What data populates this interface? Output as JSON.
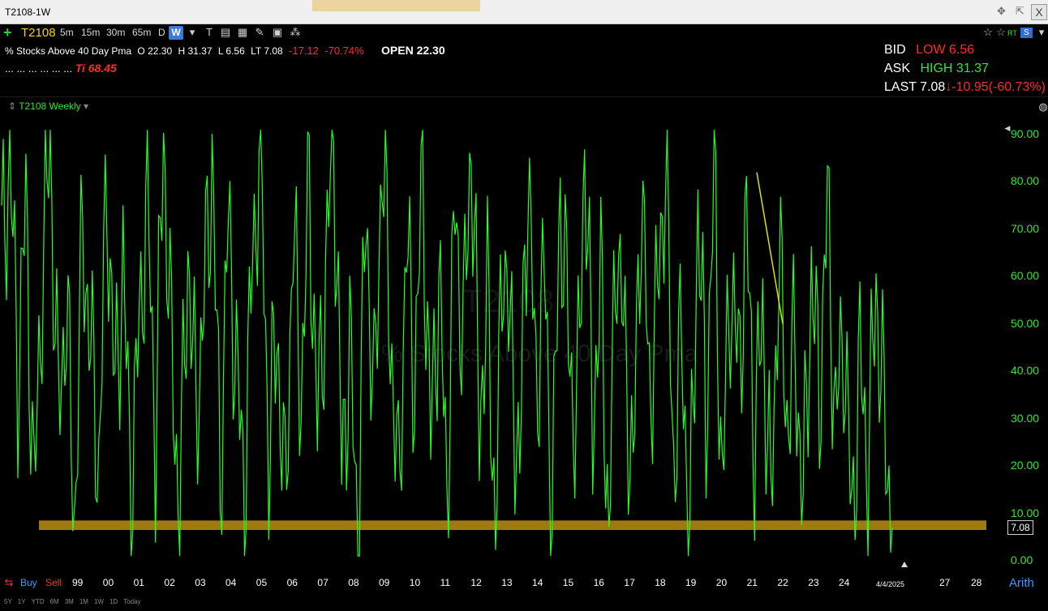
{
  "window": {
    "title": "T2108-1W"
  },
  "toolbar": {
    "symbol": "T2108",
    "intervals": [
      "5m",
      "15m",
      "30m",
      "65m",
      "D"
    ],
    "active_interval": "W",
    "rt_label": "RT"
  },
  "info": {
    "description": "% Stocks Above 40 Day Pma",
    "open": "O 22.30",
    "high": "H 31.37",
    "low": "L 6.56",
    "last": "LT 7.08",
    "change": "-17.12",
    "change_pct": "-70.74%",
    "open_label": "OPEN 22.30",
    "dots": "... ... ... ... ... ...",
    "ti": "Ti 68.45"
  },
  "quote": {
    "bid_label": "BID",
    "bid_value": "LOW 6.56",
    "ask_label": "ASK",
    "ask_value": "HIGH 31.37",
    "last_label": "LAST 7.08",
    "last_change": "-10.95",
    "last_pct": "(-60.73%)"
  },
  "chart_label": "T2108 Weekly",
  "watermark": "% Stocks Above 40 Day Pma",
  "watermark_symbol": "T2108",
  "current_price": "7.08",
  "bottom": {
    "buy": "Buy",
    "sell": "Sell",
    "scale": "Arith",
    "ranges": [
      "5Y",
      "1Y",
      "YTD",
      "6M",
      "3M",
      "1M",
      "1W",
      "1D",
      "Today"
    ]
  },
  "colors": {
    "series": "#22ff22",
    "band": "#a07a10",
    "trendline": "#e0e000"
  },
  "chart_data": {
    "type": "line",
    "title": "",
    "series_name": "T2108 Weekly",
    "y_ticks": [
      "90.00",
      "80.00",
      "70.00",
      "60.00",
      "50.00",
      "40.00",
      "30.00",
      "20.00",
      "10.00",
      "0.00"
    ],
    "ylim": [
      0,
      92
    ],
    "x_ticks": [
      "99",
      "00",
      "01",
      "02",
      "03",
      "04",
      "05",
      "06",
      "07",
      "08",
      "09",
      "10",
      "11",
      "12",
      "13",
      "14",
      "15",
      "16",
      "17",
      "18",
      "19",
      "20",
      "21",
      "22",
      "23",
      "24",
      "4/4/2025",
      "27",
      "28"
    ],
    "highlight_band": {
      "from": 6.5,
      "to": 8.5
    },
    "series": [
      {
        "name": "T2108 Weekly",
        "values": [
          65,
          85,
          40,
          75,
          12,
          60,
          88,
          30,
          55,
          8,
          70,
          45,
          20,
          80,
          35,
          62,
          14,
          50,
          78,
          25,
          90,
          42,
          10,
          66,
          30,
          55,
          85,
          18,
          72,
          40,
          15,
          65,
          88,
          22,
          50,
          10,
          70,
          35,
          80,
          28,
          60,
          92,
          20,
          45,
          5,
          75,
          30,
          88,
          50,
          12,
          68,
          38,
          82,
          25,
          60,
          15,
          75,
          45,
          90,
          30,
          55,
          8,
          70,
          40,
          20,
          85,
          35,
          62,
          10,
          78,
          48,
          25,
          88,
          30,
          58,
          6,
          72,
          42,
          18,
          80,
          35,
          55,
          85,
          20,
          48,
          2,
          75,
          30,
          82,
          15,
          60,
          40,
          70,
          25,
          52,
          10,
          65,
          30,
          45,
          12,
          60,
          35,
          75,
          28,
          50,
          8,
          42,
          20,
          58,
          30,
          7
        ]
      }
    ]
  }
}
